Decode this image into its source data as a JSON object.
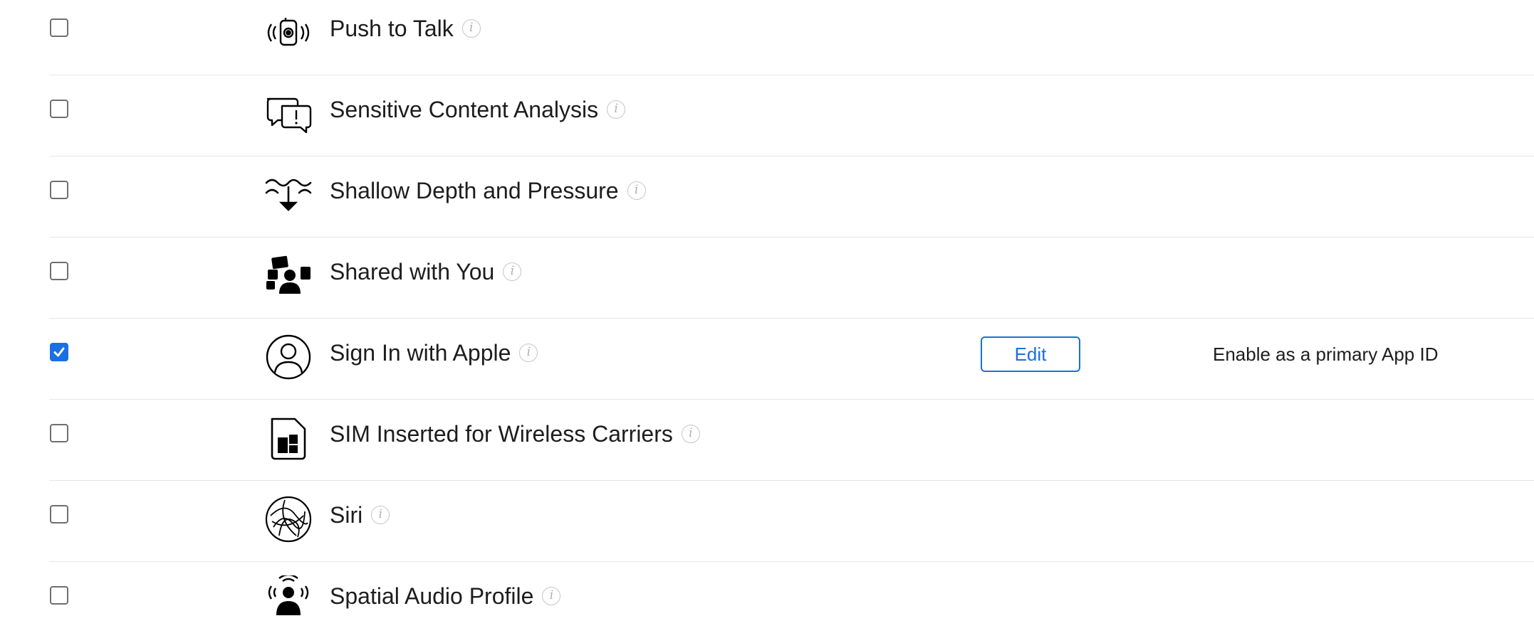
{
  "capabilities": [
    {
      "name": "Push to Talk",
      "checked": false,
      "icon": "push-to-talk-icon"
    },
    {
      "name": "Sensitive Content Analysis",
      "checked": false,
      "icon": "chat-bubbles-alert-icon"
    },
    {
      "name": "Shallow Depth and Pressure",
      "checked": false,
      "icon": "depth-pressure-icon"
    },
    {
      "name": "Shared with You",
      "checked": false,
      "icon": "shared-with-you-icon"
    },
    {
      "name": "Sign In with Apple",
      "checked": true,
      "icon": "person-circle-icon",
      "action": "Edit",
      "note": "Enable as a primary App ID"
    },
    {
      "name": "SIM Inserted for Wireless Carriers",
      "checked": false,
      "icon": "sim-card-icon"
    },
    {
      "name": "Siri",
      "checked": false,
      "icon": "siri-icon"
    },
    {
      "name": "Spatial Audio Profile",
      "checked": false,
      "icon": "spatial-audio-icon"
    }
  ],
  "colors": {
    "accent": "#1a6fe4",
    "text": "#1d1d1f",
    "divider": "#e6e6e6"
  }
}
